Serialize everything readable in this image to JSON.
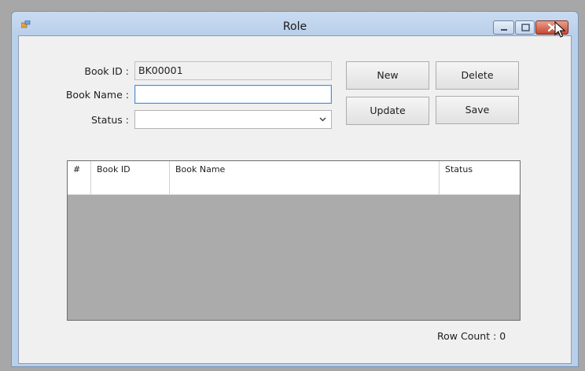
{
  "window": {
    "title": "Role"
  },
  "form": {
    "book_id_label": "Book ID :",
    "book_id_value": "BK00001",
    "book_name_label": "Book Name :",
    "book_name_value": "",
    "status_label": "Status :",
    "status_value": ""
  },
  "buttons": {
    "new": "New",
    "delete": "Delete",
    "update": "Update",
    "save": "Save"
  },
  "grid": {
    "columns": [
      "#",
      "Book ID",
      "Book Name",
      "Status"
    ],
    "rows": [
      [
        "",
        "",
        "",
        ""
      ]
    ]
  },
  "footer": {
    "row_count": "Row Count : 0"
  },
  "colors": {
    "titlebar": "#b9cfea",
    "client_bg": "#f0f0f0",
    "grid_bg": "#ababab",
    "close_button": "#c8462d"
  }
}
